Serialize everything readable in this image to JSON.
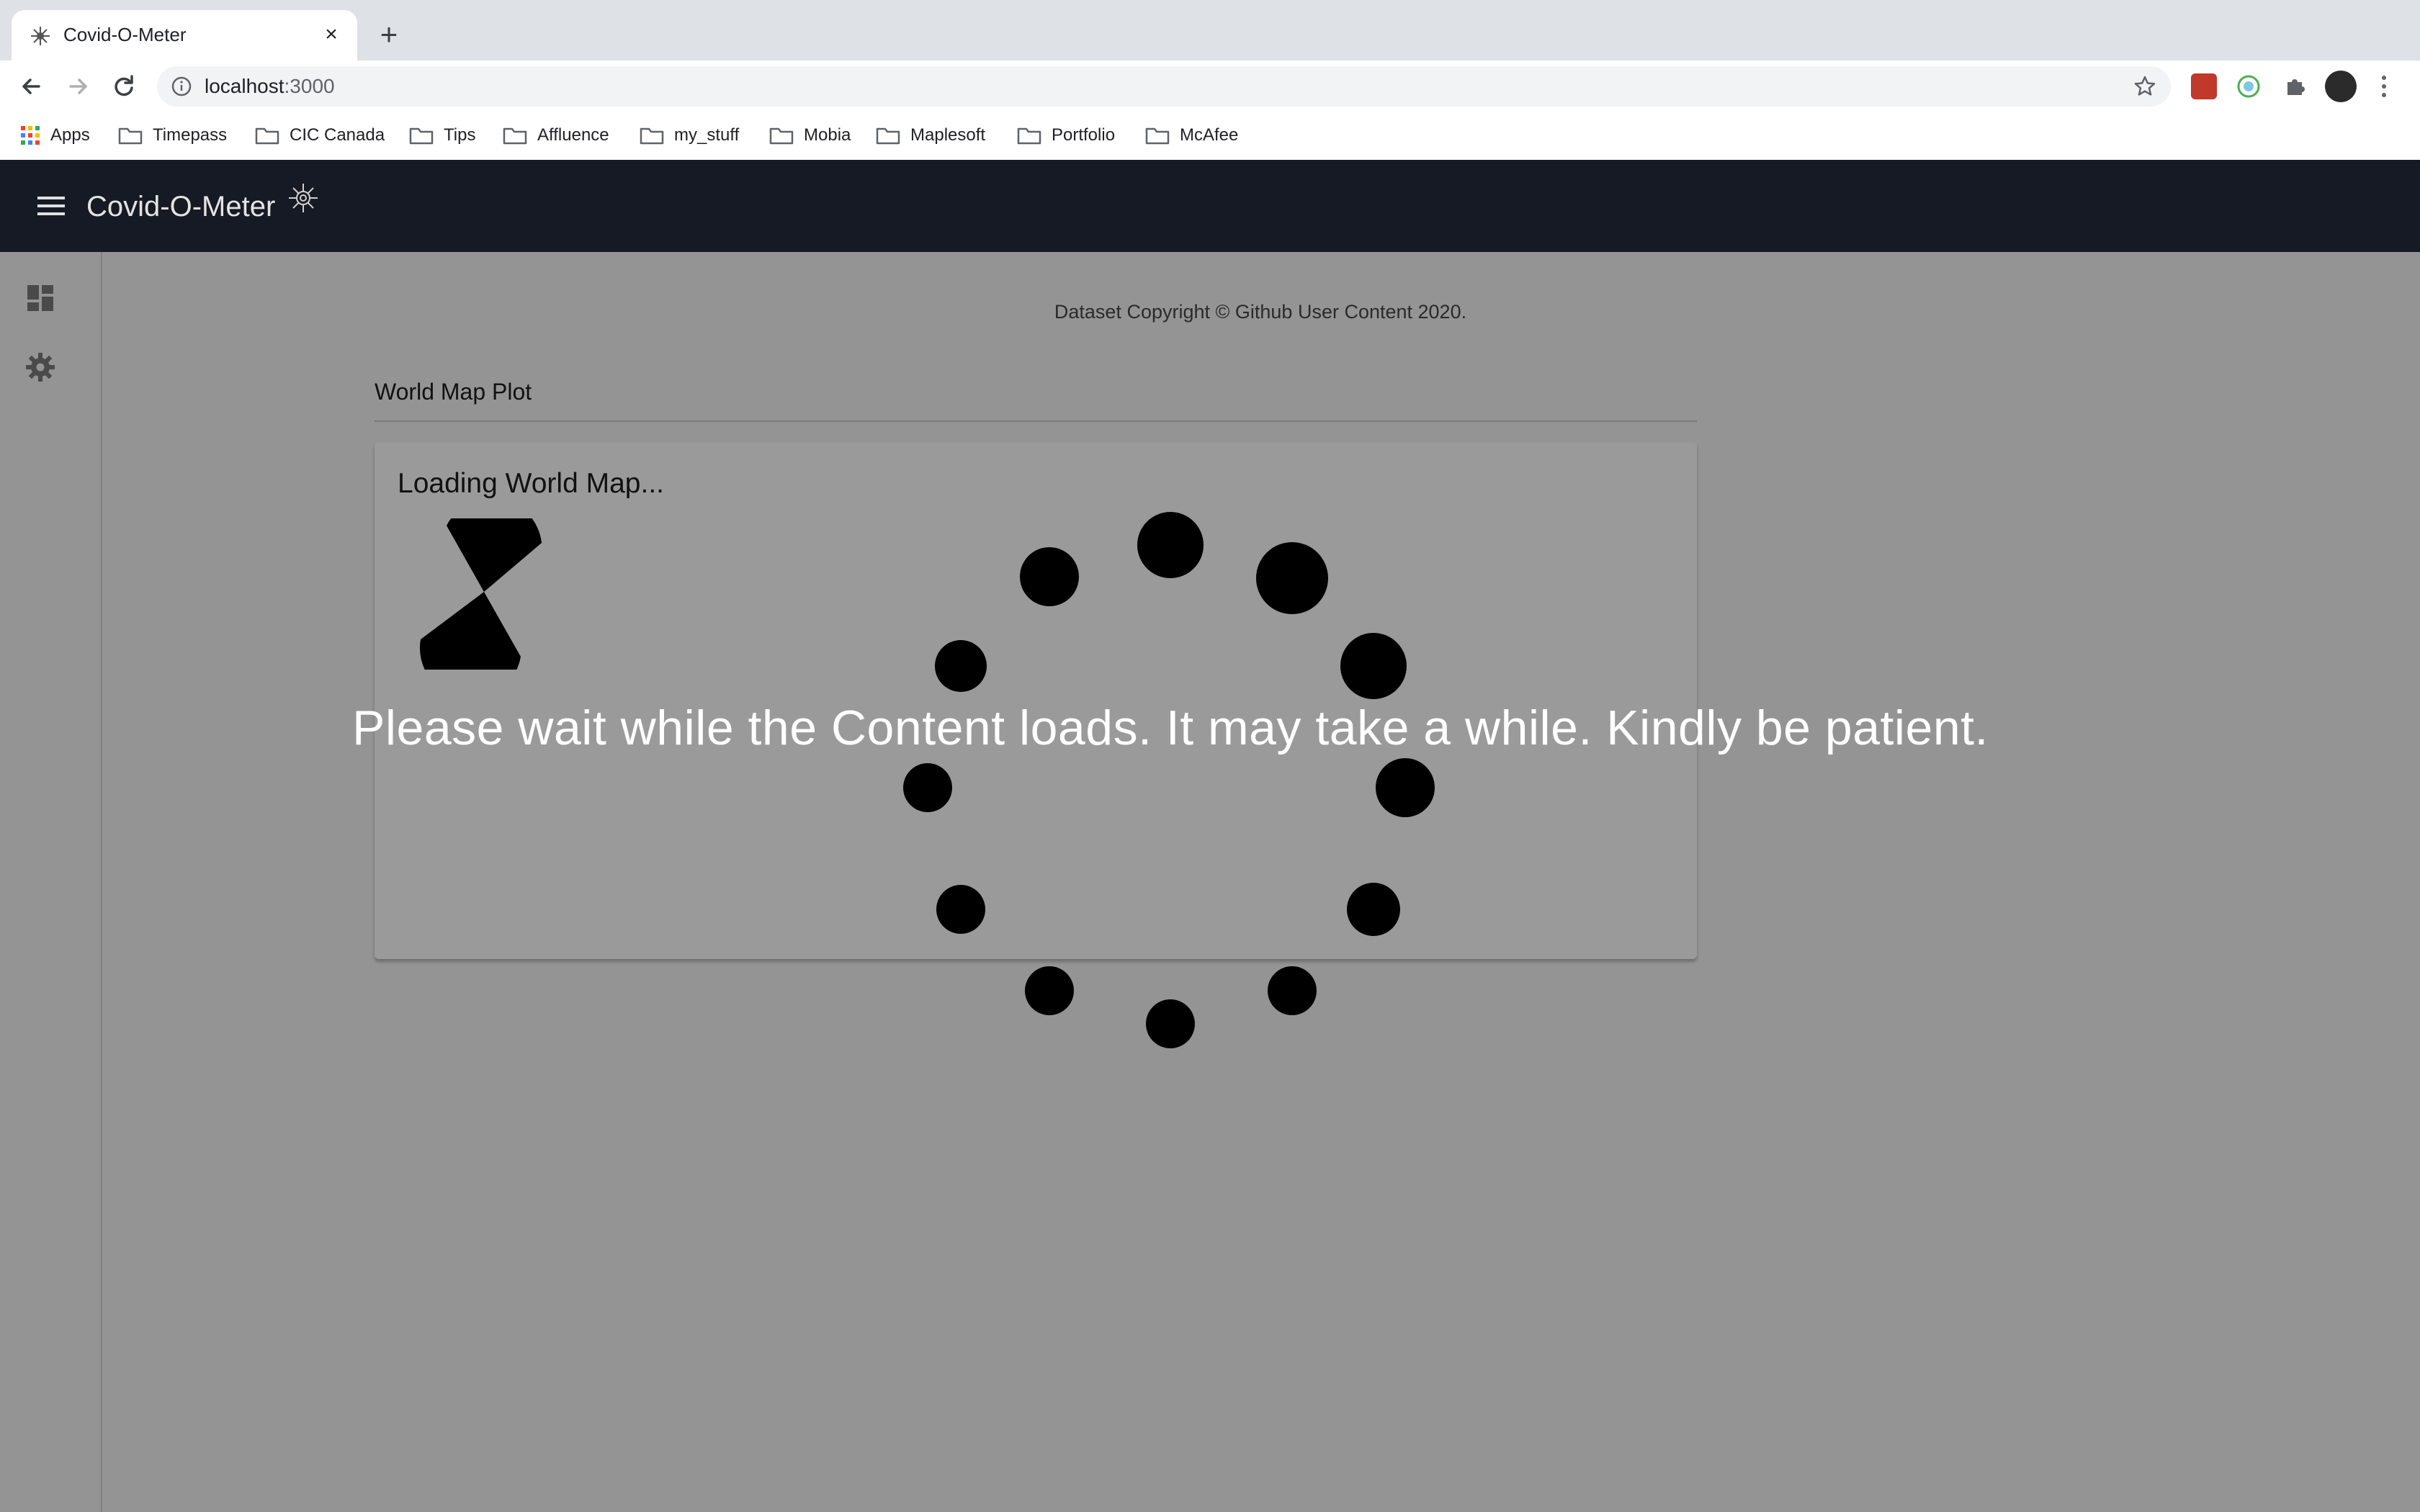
{
  "browser": {
    "tab_title": "Covid-O-Meter",
    "tab_close": "×",
    "new_tab": "+",
    "url_host": "localhost",
    "url_port": ":3000",
    "bookmarks": [
      "Apps",
      "Timepass",
      "CIC Canada",
      "Tips",
      "Affluence",
      "my_stuff",
      "Mobia",
      "Maplesoft",
      "Portfolio",
      "McAfee"
    ]
  },
  "app": {
    "title": "Covid-O-Meter",
    "sidebar": {
      "items": [
        {
          "icon": "dashboard-icon"
        },
        {
          "icon": "settings-icon"
        }
      ]
    },
    "copyright": "Dataset Copyright © Github User Content 2020.",
    "section_title": "World Map Plot",
    "loading_title": "Loading World Map...",
    "wait_message": "Please wait while the Content loads. It may take a while. Kindly be patient."
  },
  "colors": {
    "header_bg": "#151a24",
    "overlay_bg": "#949494",
    "card_bg": "#9a9a9a"
  }
}
